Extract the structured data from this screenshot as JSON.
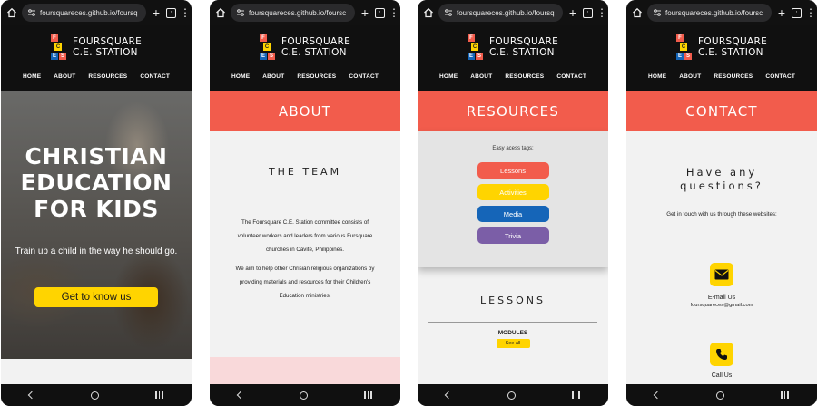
{
  "browser": {
    "url": "foursquareces.github.io/foursq",
    "url_alt": "foursquareces.github.io/foursc",
    "tab_count": ":"
  },
  "site": {
    "logo_line1": "FOURSQUARE",
    "logo_line2": "C.E. STATION",
    "logo_letters": [
      "F",
      "C",
      "E",
      "S"
    ],
    "nav": [
      "HOME",
      "ABOUT",
      "RESOURCES",
      "CONTACT"
    ]
  },
  "home": {
    "title_lines": [
      "CHRISTIAN",
      "EDUCATION",
      "FOR KIDS"
    ],
    "subtitle": "Train up a child in the way he should go.",
    "cta": "Get to know us"
  },
  "about": {
    "banner": "ABOUT",
    "section_title": "THE TEAM",
    "para1": "The Foursquare C.E. Station committee consists of volunteer workers and leaders from various Fursquare churches in Cavite, Philippines.",
    "para2": "We aim to help other Chrisian religious organizations by providing materials and resources for their Children's Education ministries."
  },
  "resources": {
    "banner": "RESOURCES",
    "tags_hint": "Easy acess tags:",
    "tags": [
      "Lessons",
      "Activities",
      "Media",
      "Trivia"
    ],
    "section_title": "LESSONS",
    "modules_label": "MODULES",
    "see_all": "See all"
  },
  "contact": {
    "banner": "CONTACT",
    "heading_line1": "Have any",
    "heading_line2": "questions?",
    "intro": "Get in touch with us through these websites:",
    "email_label": "E-mail Us",
    "email": "foursquareces@gmail.com",
    "call_label": "Call Us"
  },
  "colors": {
    "coral": "#f25c4c",
    "yellow": "#ffd400",
    "lessons": "#f25c4c",
    "activities": "#ffd400",
    "media": "#1565b8",
    "trivia": "#7b5ea7",
    "header": "#101010"
  }
}
